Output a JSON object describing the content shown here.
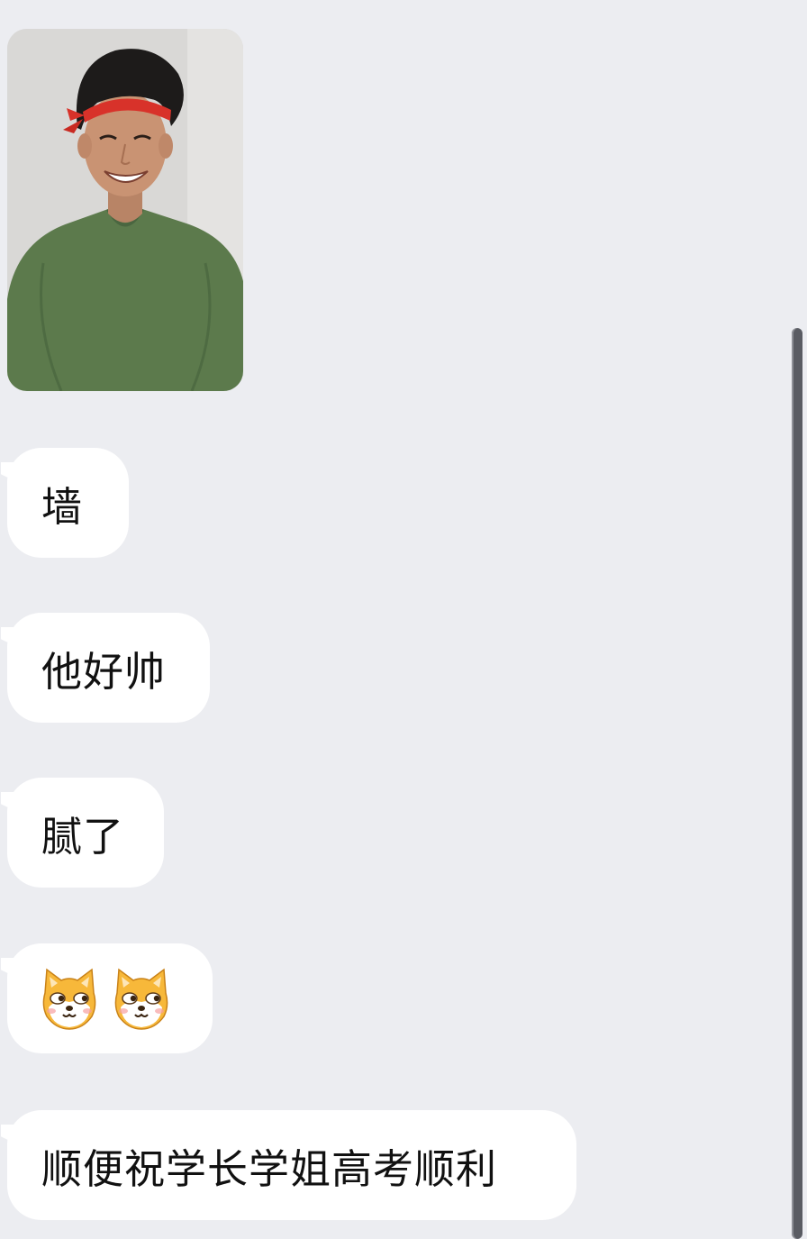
{
  "colors": {
    "background": "#ecedf1",
    "bubble": "#ffffff",
    "text": "#111111",
    "scrollbar": "#5a5c63"
  },
  "conversation": {
    "messages": [
      {
        "type": "image",
        "description_icon": "photo-message"
      },
      {
        "type": "text",
        "text": "墙"
      },
      {
        "type": "text",
        "text": "他好帅"
      },
      {
        "type": "text",
        "text": "腻了"
      },
      {
        "type": "stickers",
        "icons": [
          "shiba-smirk-emoji",
          "shiba-smirk-emoji"
        ]
      },
      {
        "type": "text",
        "text": "顺便祝学长学姐高考顺利"
      }
    ]
  }
}
